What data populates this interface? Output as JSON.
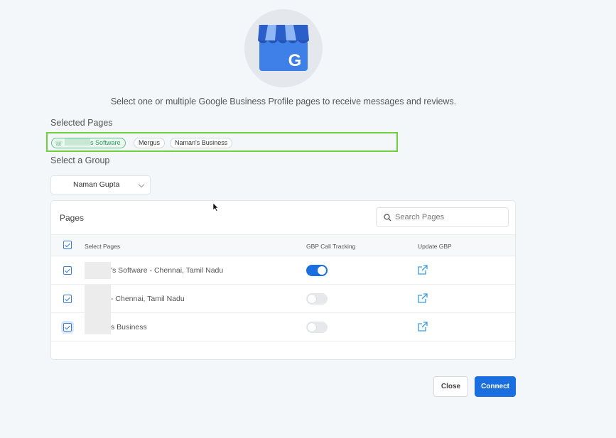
{
  "logo": {
    "icon": "google-business-store-icon",
    "letter": "G"
  },
  "subtitle": "Select one or multiple Google Business Profile pages to receive messages and reviews.",
  "selected_pages": {
    "label": "Selected Pages",
    "chips": [
      {
        "label": "s Software",
        "icon": "phone-icon",
        "active": true
      },
      {
        "label": "Mergus",
        "active": false
      },
      {
        "label": "Naman's Business",
        "active": false
      }
    ]
  },
  "group": {
    "label": "Select a Group",
    "selected": "Naman Gupta"
  },
  "pages_card": {
    "title": "Pages",
    "search_placeholder": "Search Pages",
    "columns": [
      "Select Pages",
      "GBP Call Tracking",
      "Update GBP"
    ],
    "rows": [
      {
        "name": "'s Software - Chennai, Tamil Nadu",
        "checked": true,
        "call_tracking": true
      },
      {
        "name": "- Chennai, Tamil Nadu",
        "checked": true,
        "call_tracking": false
      },
      {
        "name": "s Business",
        "checked": true,
        "call_tracking": false
      }
    ]
  },
  "buttons": {
    "close": "Close",
    "connect": "Connect"
  },
  "colors": {
    "primary": "#1a6fe0",
    "highlight_border": "#6fd03a",
    "chip_active": "#2e9a5c"
  }
}
